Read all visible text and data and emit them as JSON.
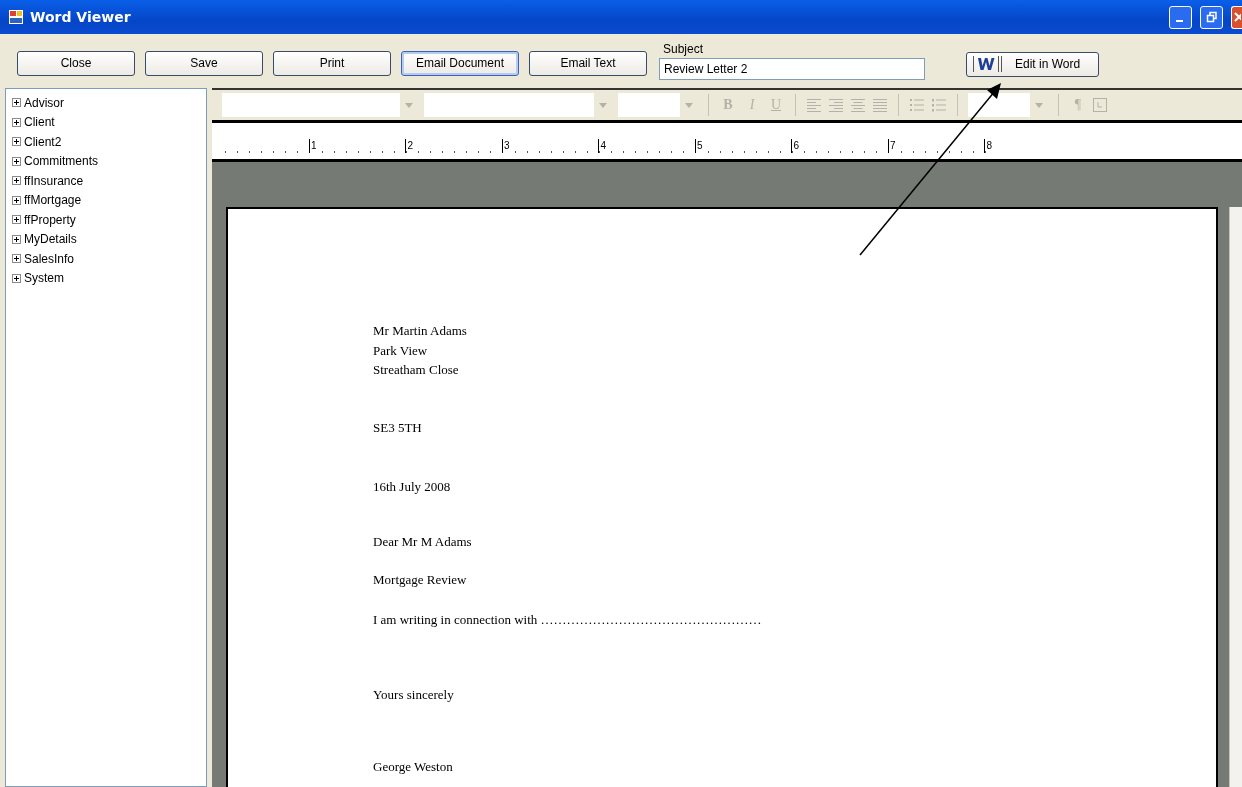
{
  "window": {
    "title": "Word Viewer"
  },
  "buttons": [
    {
      "label": "Close",
      "selected": false
    },
    {
      "label": "Save",
      "selected": false
    },
    {
      "label": "Print",
      "selected": false
    },
    {
      "label": "Email Document",
      "selected": true
    },
    {
      "label": "Email Text",
      "selected": false
    }
  ],
  "subject": {
    "label": "Subject",
    "value": "Review Letter 2"
  },
  "edit_button": {
    "label": "Edit in Word"
  },
  "tree": {
    "items": [
      {
        "label": "Advisor",
        "expanded": false
      },
      {
        "label": "Client",
        "expanded": false
      },
      {
        "label": "Client2",
        "expanded": false
      },
      {
        "label": "Commitments",
        "expanded": false
      },
      {
        "label": "ffInsurance",
        "expanded": false
      },
      {
        "label": "ffMortgage",
        "expanded": false
      },
      {
        "label": "ffProperty",
        "expanded": false
      },
      {
        "label": "MyDetails",
        "expanded": false
      },
      {
        "label": "SalesInfo",
        "expanded": false
      },
      {
        "label": "System",
        "expanded": false
      }
    ]
  },
  "format_toolbar": {
    "disabled": true,
    "bold": "B",
    "italic": "I",
    "underline": "U",
    "pilcrow": "¶"
  },
  "ruler": {
    "labels": [
      "1",
      "2",
      "3",
      "4",
      "5",
      "6",
      "7",
      "8"
    ]
  },
  "letter": {
    "paragraphs": [
      {
        "lines": [
          "Mr Martin Adams",
          "Park View",
          "Streatham Close"
        ]
      },
      {
        "lines": [
          "SE3 5TH"
        ]
      },
      {
        "lines": [
          "16th July 2008"
        ]
      },
      {
        "lines": [
          "Dear Mr M Adams"
        ]
      },
      {
        "lines": [
          "Mortgage Review"
        ]
      },
      {
        "lines": [
          "I am writing in connection with ……………………………………………"
        ]
      },
      {
        "lines": [
          "Yours sincerely"
        ]
      },
      {
        "lines": [
          "George Weston"
        ]
      }
    ]
  }
}
